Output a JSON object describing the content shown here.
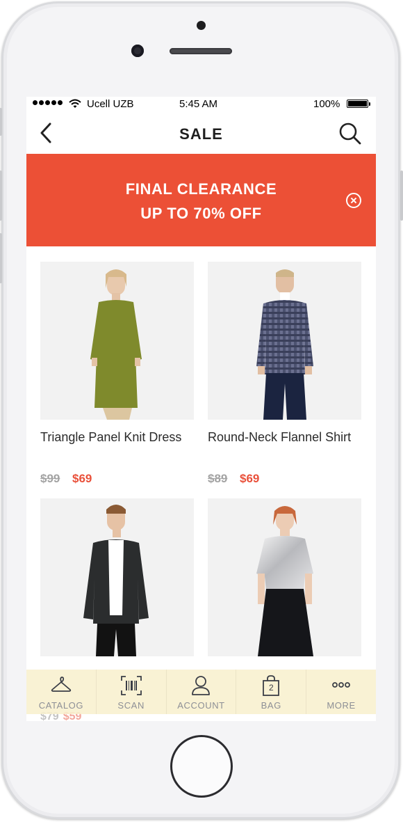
{
  "status_bar": {
    "carrier": "Ucell UZB",
    "time": "5:45 AM",
    "battery": "100%"
  },
  "navbar": {
    "title": "SALE",
    "back_icon": "chevron-left-icon",
    "search_icon": "search-icon"
  },
  "banner": {
    "line1": "FINAL CLEARANCE",
    "line2": "UP TO 70% OFF",
    "background": "#ec5036",
    "close_icon": "close-circle-icon"
  },
  "products": [
    {
      "name": "Triangle Panel Knit Dress",
      "old_price": "$99",
      "price": "$69"
    },
    {
      "name": "Round-Neck Flannel Shirt",
      "old_price": "$89",
      "price": "$69"
    },
    {
      "name": "",
      "old_price": "",
      "price": ""
    },
    {
      "name": "",
      "old_price": "",
      "price": ""
    }
  ],
  "peek_prices": {
    "old_price": "$79",
    "price": "$59"
  },
  "tabbar": {
    "tabs": [
      {
        "label": "CATALOG",
        "icon": "hanger-icon"
      },
      {
        "label": "SCAN",
        "icon": "barcode-scan-icon"
      },
      {
        "label": "ACCOUNT",
        "icon": "user-icon"
      },
      {
        "label": "BAG",
        "icon": "shopping-bag-icon",
        "badge": "2"
      },
      {
        "label": "MORE",
        "icon": "more-dots-icon"
      }
    ]
  },
  "colors": {
    "accent": "#ec5036",
    "price_sale": "#e9503a",
    "price_old": "#a3a3a3",
    "tabbar_bg": "#f8f0ce",
    "tab_label": "#8d8f96"
  }
}
